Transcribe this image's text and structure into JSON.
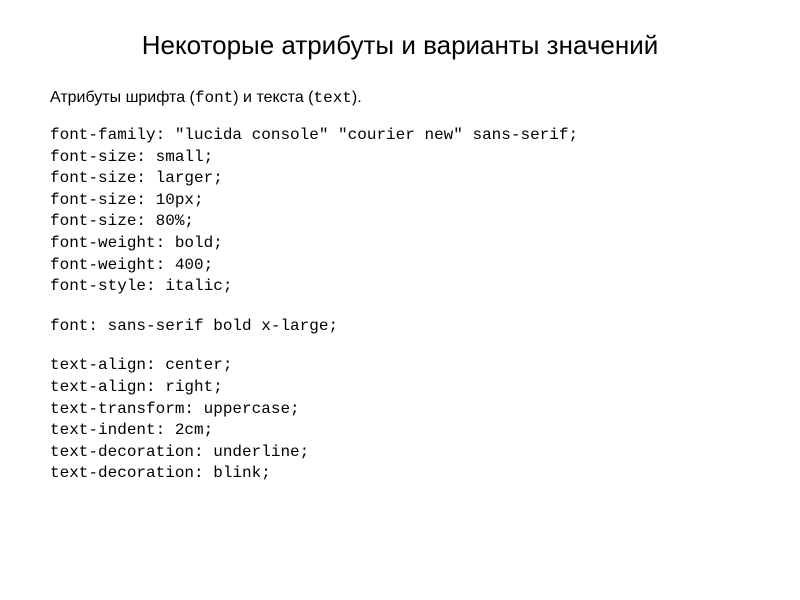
{
  "title": "Некоторые атрибуты и варианты значений",
  "subtitle": {
    "part1": "Атрибуты шрифта (",
    "mono1": "font",
    "part2": ") и текста (",
    "mono2": "text",
    "part3": ")."
  },
  "code": {
    "block1": "font-family: \"lucida console\" \"courier new\" sans-serif;\nfont-size: small;\nfont-size: larger;\nfont-size: 10px;\nfont-size: 80%;\nfont-weight: bold;\nfont-weight: 400;\nfont-style: italic;",
    "block2": "font: sans-serif bold x-large;",
    "block3": "text-align: center;\ntext-align: right;\ntext-transform: uppercase;\ntext-indent: 2cm;\ntext-decoration: underline;\ntext-decoration: blink;"
  }
}
